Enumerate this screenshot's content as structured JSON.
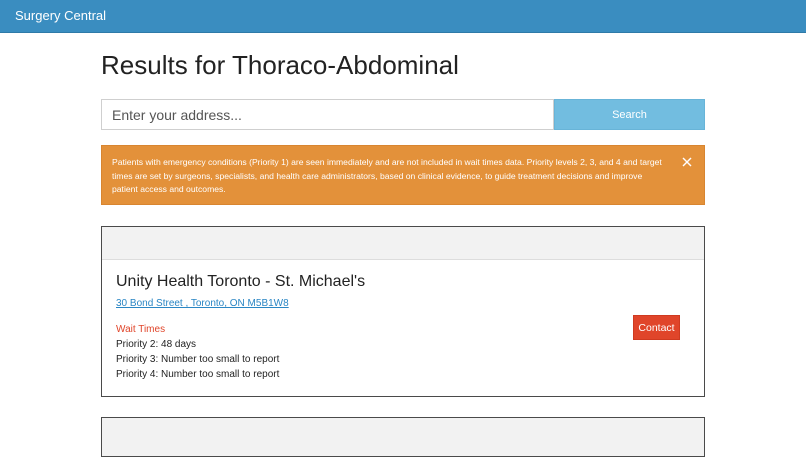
{
  "app": {
    "brand": "Surgery Central"
  },
  "page": {
    "title": "Results for Thoraco-Abdominal"
  },
  "search": {
    "placeholder": "Enter your address...",
    "value": "",
    "button_label": "Search"
  },
  "alert": {
    "text": "Patients with emergency conditions (Priority 1) are seen immediately and are not included in wait times data. Priority levels 2, 3, and 4 and target times are set by surgeons, specialists, and health care administrators, based on clinical evidence, to guide treatment decisions and improve patient access and outcomes.",
    "close_icon": "close-icon"
  },
  "results": [
    {
      "name": "Unity Health Toronto - St. Michael's",
      "address": "30 Bond Street , Toronto, ON M5B1W8",
      "wait_times_label": "Wait Times",
      "wait_times": [
        "Priority 2: 48 days",
        "Priority 3: Number too small to report",
        "Priority 4: Number too small to report"
      ],
      "contact_label": "Contact"
    }
  ],
  "colors": {
    "topbar": "#3a8dc0",
    "search_button": "#72bde0",
    "alert": "#e3913a",
    "contact": "#e0452a",
    "link": "#2a86c4"
  }
}
